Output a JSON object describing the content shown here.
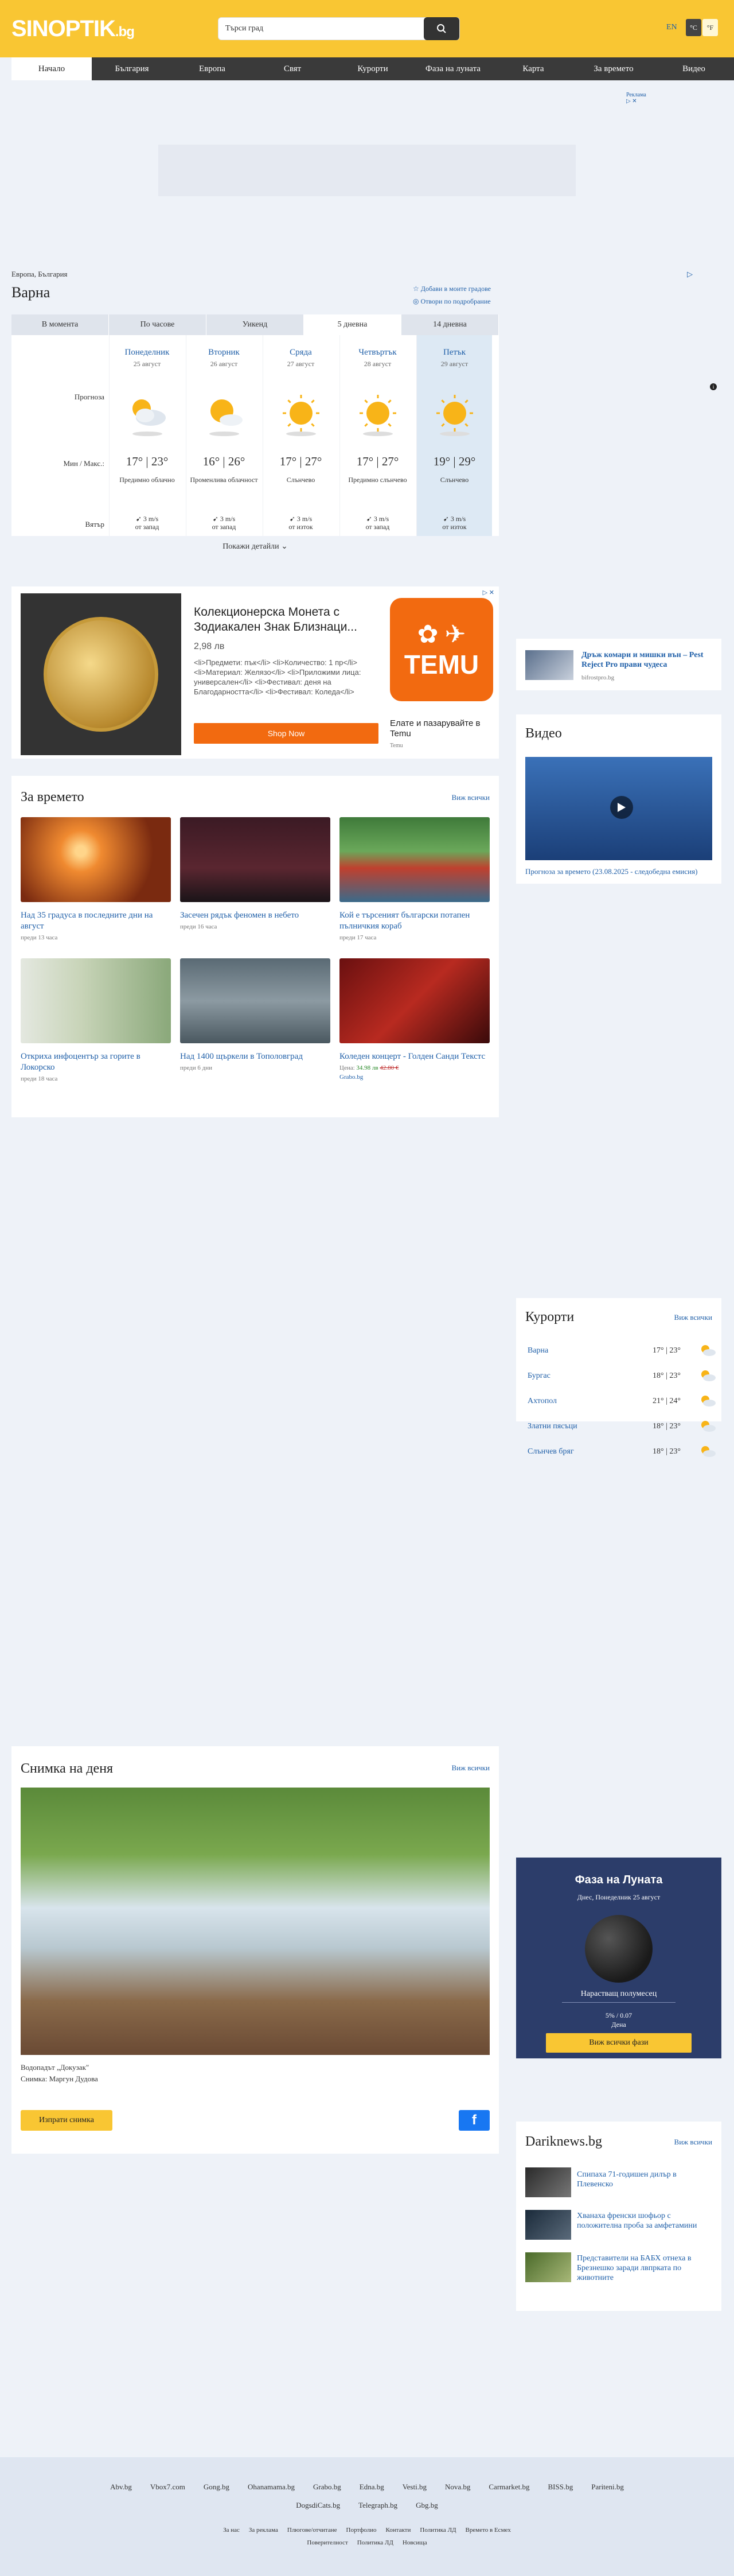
{
  "header": {
    "logo_main": "SINOPTIK",
    "logo_tld": ".bg",
    "search_placeholder": "Търси град",
    "lang": "EN",
    "unit_c": "°C",
    "unit_f": "°F"
  },
  "nav": [
    "Начало",
    "България",
    "Европа",
    "Свят",
    "Курорти",
    "Фаза на луната",
    "Карта",
    "За времето",
    "Видео"
  ],
  "ad": {
    "label": "Реклама",
    "mark": "▷ ✕"
  },
  "location": {
    "breadcrumb": "Европа, България",
    "city": "Варна",
    "add_link": "Добави в моите градове",
    "detail_link": "Отвори по подробрание"
  },
  "tabs": [
    "В момента",
    "По часове",
    "Уикенд",
    "5 дневна",
    "14 дневна"
  ],
  "forecast": {
    "row_labels": {
      "forecast": "Прогноза",
      "minmax": "Мин / Макс.:",
      "wind": "Вятър"
    },
    "days": [
      {
        "name": "Понеделник",
        "date": "25 август",
        "min": "17°",
        "max": "23°",
        "desc": "Предимно облачно",
        "wind": "3 m/s",
        "wind_dir": "от запад",
        "icon": "partly-cloudy-icon"
      },
      {
        "name": "Вторник",
        "date": "26 август",
        "min": "16°",
        "max": "26°",
        "desc": "Променлива облачност",
        "wind": "3 m/s",
        "wind_dir": "от запад",
        "icon": "sun-cloud-icon"
      },
      {
        "name": "Сряда",
        "date": "27 август",
        "min": "17°",
        "max": "27°",
        "desc": "Слънчево",
        "wind": "3 m/s",
        "wind_dir": "от изток",
        "icon": "sun-icon"
      },
      {
        "name": "Четвъртък",
        "date": "28 август",
        "min": "17°",
        "max": "27°",
        "desc": "Предимно слънчево",
        "wind": "3 m/s",
        "wind_dir": "от запад",
        "icon": "sun-icon"
      },
      {
        "name": "Петък",
        "date": "29 август",
        "min": "19°",
        "max": "29°",
        "desc": "Слънчево",
        "wind": "3 m/s",
        "wind_dir": "от изток",
        "icon": "sun-icon"
      }
    ],
    "more_details": "Покажи детайли ⌄"
  },
  "promo": {
    "title": "Колекционерска Монета с Зодиакален Знак Близнаци...",
    "price": "2,98 лв",
    "desc": "<li>Предмети: пък</li> <li>Количество: 1 пр</li> <li>Материал: Желязо</li> <li>Приложими лица: универсален</li> <li>Фестивал: деня на Благодарността</li> <li>Фестивал: Коледа</li>",
    "button": "Shop Now",
    "brand": "TEMU",
    "cta": "Елате и пазарувайте в Temu",
    "sub": "Temu"
  },
  "side_ad": {
    "title": "Дръж комари и мишки вън – Pest Reject Pro прави чудеса",
    "source": "bifrostpro.bg"
  },
  "video": {
    "title": "Видео",
    "caption": "Прогноза за времето (23.08.2025 - следобедна емисия)"
  },
  "news": {
    "title": "За времето",
    "all": "Виж всички",
    "items": [
      {
        "title": "Над 35 градуса в последните дни на август",
        "ago": "преди 13 часа"
      },
      {
        "title": "Засечен рядък феномен в небето",
        "ago": "преди 16 часа"
      },
      {
        "title": "Кой е търсеният български потапен пълничкия кораб",
        "ago": "преди 17 часа"
      },
      {
        "title": "Откриха инфоцентър за горите в Локорско",
        "ago": "преди 18 часа"
      },
      {
        "title": "Над 1400 щъркели в Тополовград",
        "ago": "преди 6 дни"
      },
      {
        "title": "Коледен концерт - Голден Санди Текстс",
        "price_label": "Цена:",
        "price_new": "34.98 лв",
        "price_old": "42.80 €",
        "source": "Grabo.bg"
      }
    ]
  },
  "resorts": {
    "title": "Курорти",
    "all": "Виж всички",
    "items": [
      {
        "name": "Варна",
        "t": "17° | 23°"
      },
      {
        "name": "Бургас",
        "t": "18° | 23°"
      },
      {
        "name": "Ахтопол",
        "t": "21° | 24°"
      },
      {
        "name": "Златни пясъци",
        "t": "18° | 23°"
      },
      {
        "name": "Слънчев бряг",
        "t": "18° | 23°"
      }
    ]
  },
  "photo": {
    "title": "Снимка на деня",
    "all": "Виж всички",
    "caption": "Водопадът „Докузак\"",
    "author_label": "Снимка:",
    "author": "Маргун Дудова",
    "button": "Изпрати снимка"
  },
  "moon": {
    "title": "Фаза на Луната",
    "date": "Днес, Понеделник 25 август",
    "phase": "Нарастващ полумесец",
    "percent": "5% / 0.07",
    "age": "Дена",
    "button": "Виж всички фази"
  },
  "darik": {
    "title": "Dariknews.bg",
    "all": "Виж всички",
    "items": [
      "Спипаха 71-годишен дилър в Плевенско",
      "Хванаха френски шофьор с положителна проба за амфетамини",
      "Представители на БАБХ отнеха в Брезнешко заради лвпрката по животните"
    ]
  },
  "footer": {
    "row1": [
      "Abv.bg",
      "Vbox7.com",
      "Gong.bg",
      "Ohanamama.bg",
      "Grabo.bg",
      "Edna.bg",
      "Vesti.bg",
      "Nova.bg",
      "Carmarket.bg",
      "BISS.bg",
      "Pariteni.bg"
    ],
    "row2": [
      "DogsdiCats.bg",
      "Telegraph.bg",
      "Gbg.bg"
    ],
    "row3": [
      "За нас",
      "За реклама",
      "Плюгове/отчитане",
      "Портфолио",
      "Контакти",
      "Политика ЛД",
      "Времето в Есмeх"
    ],
    "row4": [
      "Поверителност",
      "Политика ЛД",
      "Новсища"
    ]
  }
}
